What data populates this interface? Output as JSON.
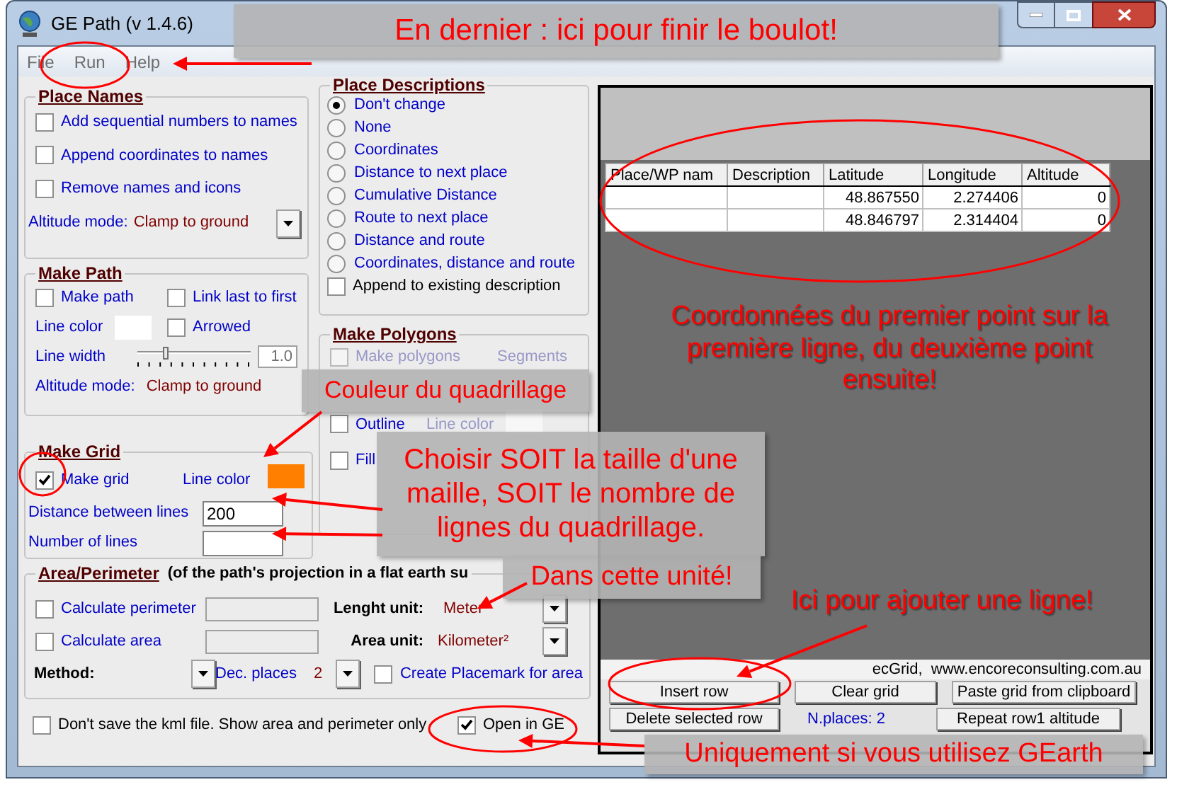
{
  "window": {
    "title": "GE Path (v 1.4.6)"
  },
  "menu": [
    {
      "label": "File"
    },
    {
      "label": "Run"
    },
    {
      "label": "Help"
    }
  ],
  "place_names": {
    "title": "Place Names",
    "options": [
      {
        "label": "Add sequential numbers to names",
        "checked": false
      },
      {
        "label": "Append coordinates to names",
        "checked": false
      },
      {
        "label": "Remove names and icons",
        "checked": false
      }
    ],
    "altitude_label": "Altitude mode:",
    "altitude_value": "Clamp to ground"
  },
  "make_path": {
    "title": "Make Path",
    "make_path": {
      "label": "Make path",
      "checked": false
    },
    "link_last": {
      "label": "Link last to first",
      "checked": false
    },
    "line_color_label": "Line color",
    "arrowed": {
      "label": "Arrowed",
      "checked": false
    },
    "line_width_label": "Line width",
    "line_width": {
      "level": 0.26,
      "value": "1.0"
    },
    "altitude_label": "Altitude mode:",
    "altitude_value": "Clamp to ground"
  },
  "make_grid": {
    "title": "Make Grid",
    "make_grid": {
      "label": "Make grid",
      "checked": true
    },
    "line_color_label": "Line color",
    "distance_label": "Distance between lines",
    "distance_value": "200",
    "number_label": "Number of  lines"
  },
  "place_descriptions": {
    "title": "Place Descriptions",
    "options": [
      {
        "label": "Don't change",
        "selected": true
      },
      {
        "label": "None",
        "selected": false
      },
      {
        "label": "Coordinates",
        "selected": false
      },
      {
        "label": "Distance to next place",
        "selected": false
      },
      {
        "label": "Cumulative Distance",
        "selected": false
      },
      {
        "label": "Route to next place",
        "selected": false
      },
      {
        "label": "Distance and route",
        "selected": false
      },
      {
        "label": "Coordinates, distance and route",
        "selected": false
      }
    ],
    "append": {
      "label": "Append to existing description",
      "checked": false
    }
  },
  "make_polygons": {
    "title": "Make Polygons",
    "disabled": true,
    "make_polygons": {
      "label": "Make polygons",
      "checked": false
    },
    "segments_label": "Segments",
    "outline": {
      "label": "Outline",
      "checked": false
    },
    "line_color_label": "Line color",
    "fill": {
      "label": "Fill",
      "checked": false
    }
  },
  "area_perimeter": {
    "title": "Area/Perimeter",
    "note": "(of the path's projection in a flat earth su",
    "perimeter": {
      "label": "Calculate perimeter",
      "checked": false
    },
    "area": {
      "label": "Calculate area",
      "checked": false
    },
    "length_unit_label": "Lenght unit:",
    "length_unit": "Meter",
    "area_unit_label": "Area unit:",
    "area_unit": "Kilometer²",
    "method_label": "Method:",
    "dec_label": "Dec. places",
    "dec_value": "2",
    "placemark": {
      "label": "Create Placemark for area",
      "checked": false
    }
  },
  "dont_save": {
    "label": "Don't save the kml file. Show area and perimeter only",
    "checked": false
  },
  "open_ge": {
    "label": "Open in GE",
    "checked": true
  },
  "grid": {
    "columns": [
      "Place/WP nam",
      "Description",
      "Latitude",
      "Longitude",
      "Altitude"
    ],
    "rows": [
      {
        "latitude": "48.867550",
        "longitude": "2.274406",
        "altitude": "0"
      },
      {
        "latitude": "48.846797",
        "longitude": "2.314404",
        "altitude": "0"
      }
    ],
    "credit": "ecGrid,  www.encoreconsulting.com.au",
    "buttons_row1": [
      "Insert row",
      "Clear grid",
      "Paste grid from clipboard"
    ],
    "places_count": "N.places: 2",
    "buttons_row2": [
      "Delete selected row",
      "Repeat row1 altitude"
    ]
  },
  "annotations": [
    {
      "text": "En dernier : ici pour finir le boulot!",
      "boxed": true
    },
    {
      "text": "Couleur du quadrillage",
      "boxed": true
    },
    {
      "text": "Choisir SOIT la taille d'une maille, SOIT le nombre de lignes du quadrillage.",
      "boxed": true
    },
    {
      "text": "Dans cette unité!",
      "boxed": true
    },
    {
      "text": "Coordonnées du premier point sur la première ligne, du deuxième point ensuite!",
      "boxed": false
    },
    {
      "text": "Ici pour ajouter une ligne!",
      "boxed": false
    },
    {
      "text": "Uniquement si vous utilisez GEarth",
      "boxed": true
    }
  ]
}
